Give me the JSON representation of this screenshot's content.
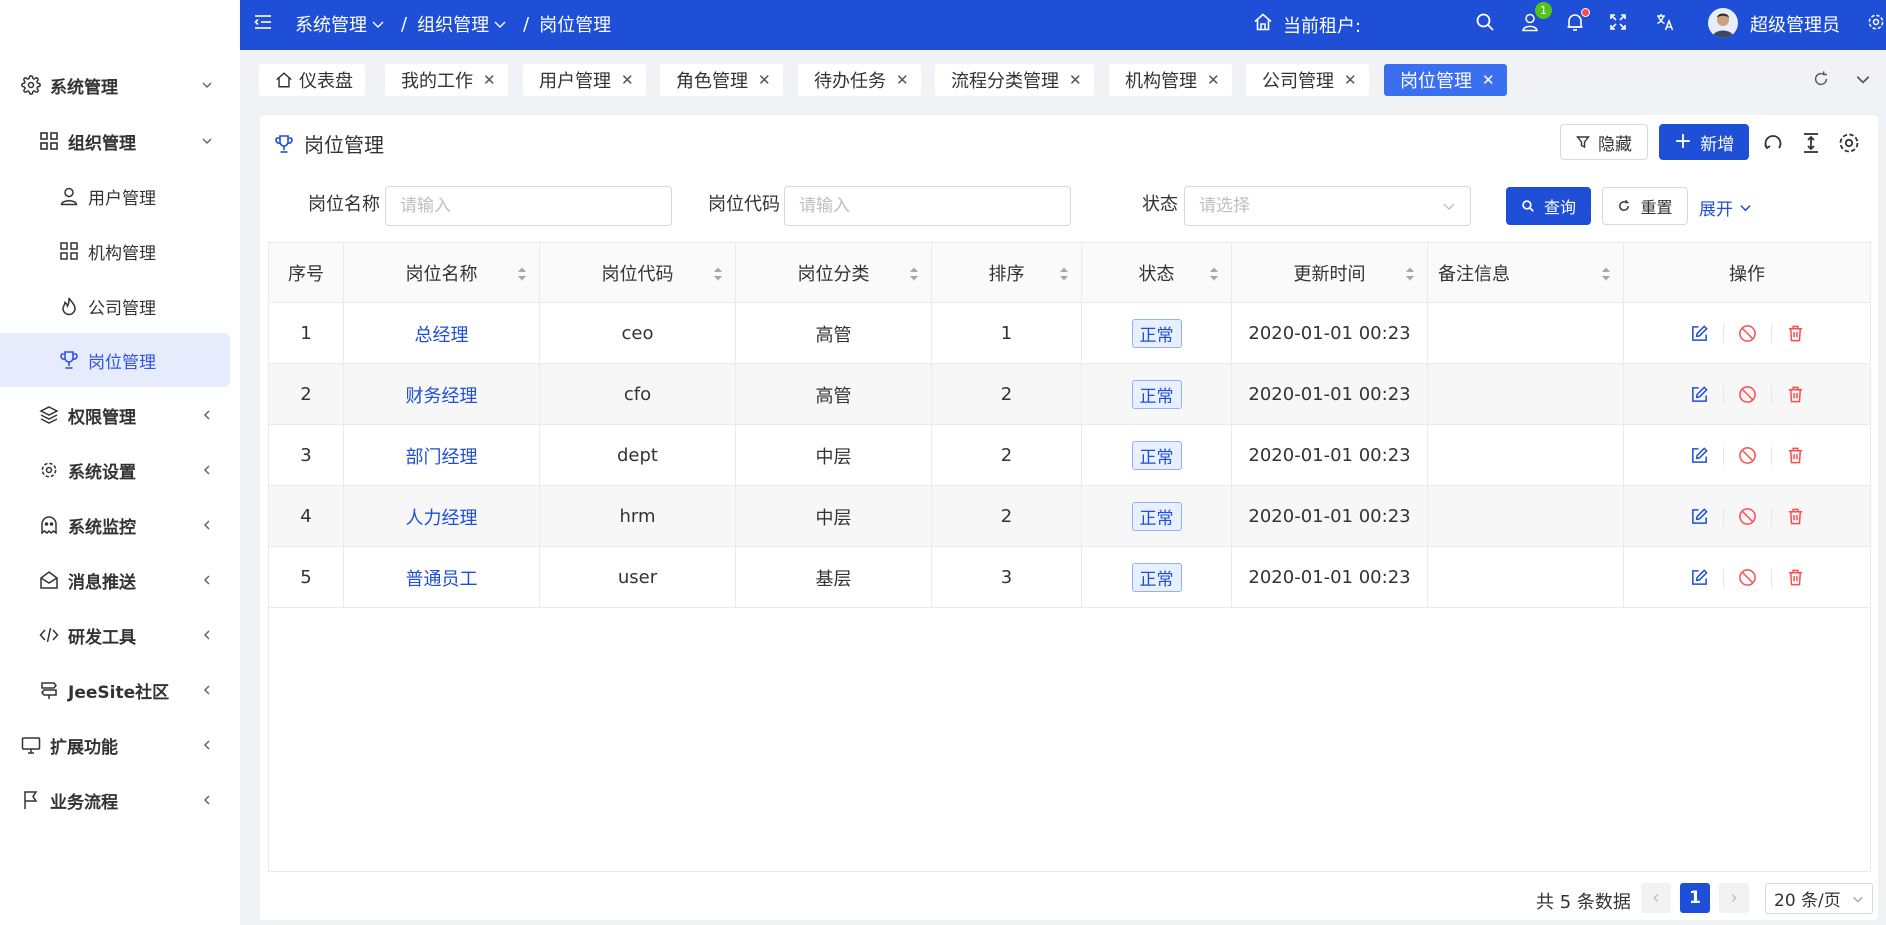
{
  "sidebar": {
    "items": [
      {
        "label": "系统管理",
        "icon": "gear-icon",
        "level": 0,
        "bold": true,
        "expanded": true
      },
      {
        "label": "组织管理",
        "icon": "grid-icon",
        "level": 1,
        "bold": true,
        "expanded": true
      },
      {
        "label": "用户管理",
        "icon": "user-icon",
        "level": 2
      },
      {
        "label": "机构管理",
        "icon": "grid-icon",
        "level": 2
      },
      {
        "label": "公司管理",
        "icon": "fire-icon",
        "level": 2
      },
      {
        "label": "岗位管理",
        "icon": "trophy-icon",
        "level": 2,
        "active": true
      },
      {
        "label": "权限管理",
        "icon": "layers-icon",
        "level": 1,
        "bold": true
      },
      {
        "label": "系统设置",
        "icon": "gear-icon",
        "level": 1,
        "bold": true
      },
      {
        "label": "系统监控",
        "icon": "ghost-icon",
        "level": 1,
        "bold": true
      },
      {
        "label": "消息推送",
        "icon": "mail-icon",
        "level": 1,
        "bold": true
      },
      {
        "label": "研发工具",
        "icon": "code-icon",
        "level": 1,
        "bold": true
      },
      {
        "label": "JeeSite社区",
        "icon": "signpost-icon",
        "level": 1,
        "bold": true
      },
      {
        "label": "扩展功能",
        "icon": "monitor-icon",
        "level": 0,
        "bold": true
      },
      {
        "label": "业务流程",
        "icon": "flag-icon",
        "level": 0,
        "bold": true
      }
    ]
  },
  "header": {
    "breadcrumb": [
      "系统管理",
      "组织管理",
      "岗位管理"
    ],
    "tenant_label": "当前租户:",
    "notification_count": "1",
    "username": "超级管理员"
  },
  "tabs": [
    {
      "label": "仪表盘",
      "icon": "home-icon",
      "closable": false
    },
    {
      "label": "我的工作",
      "closable": true
    },
    {
      "label": "用户管理",
      "closable": true
    },
    {
      "label": "角色管理",
      "closable": true
    },
    {
      "label": "待办任务",
      "closable": true
    },
    {
      "label": "流程分类管理",
      "closable": true
    },
    {
      "label": "机构管理",
      "closable": true
    },
    {
      "label": "公司管理",
      "closable": true
    },
    {
      "label": "岗位管理",
      "closable": true,
      "active": true
    }
  ],
  "page": {
    "title": "岗位管理",
    "hide_label": "隐藏",
    "add_label": "新增"
  },
  "search": {
    "name_label": "岗位名称",
    "name_placeholder": "请输入",
    "code_label": "岗位代码",
    "code_placeholder": "请输入",
    "status_label": "状态",
    "status_placeholder": "请选择",
    "query_label": "查询",
    "reset_label": "重置",
    "expand_label": "展开"
  },
  "table": {
    "headers": [
      "序号",
      "岗位名称",
      "岗位代码",
      "岗位分类",
      "排序",
      "状态",
      "更新时间",
      "备注信息",
      "操作"
    ],
    "rows": [
      {
        "no": "1",
        "name": "总经理",
        "code": "ceo",
        "category": "高管",
        "sort": "1",
        "status": "正常",
        "updated": "2020-01-01 00:23",
        "remark": ""
      },
      {
        "no": "2",
        "name": "财务经理",
        "code": "cfo",
        "category": "高管",
        "sort": "2",
        "status": "正常",
        "updated": "2020-01-01 00:23",
        "remark": ""
      },
      {
        "no": "3",
        "name": "部门经理",
        "code": "dept",
        "category": "中层",
        "sort": "2",
        "status": "正常",
        "updated": "2020-01-01 00:23",
        "remark": ""
      },
      {
        "no": "4",
        "name": "人力经理",
        "code": "hrm",
        "category": "中层",
        "sort": "2",
        "status": "正常",
        "updated": "2020-01-01 00:23",
        "remark": ""
      },
      {
        "no": "5",
        "name": "普通员工",
        "code": "user",
        "category": "基层",
        "sort": "3",
        "status": "正常",
        "updated": "2020-01-01 00:23",
        "remark": ""
      }
    ]
  },
  "pagination": {
    "total_text": "共 5 条数据",
    "current_page": "1",
    "page_size": "20 条/页"
  },
  "colors": {
    "primary": "#1e4fd6",
    "link": "#1e4fd6",
    "delete": "#ff4d4f"
  }
}
